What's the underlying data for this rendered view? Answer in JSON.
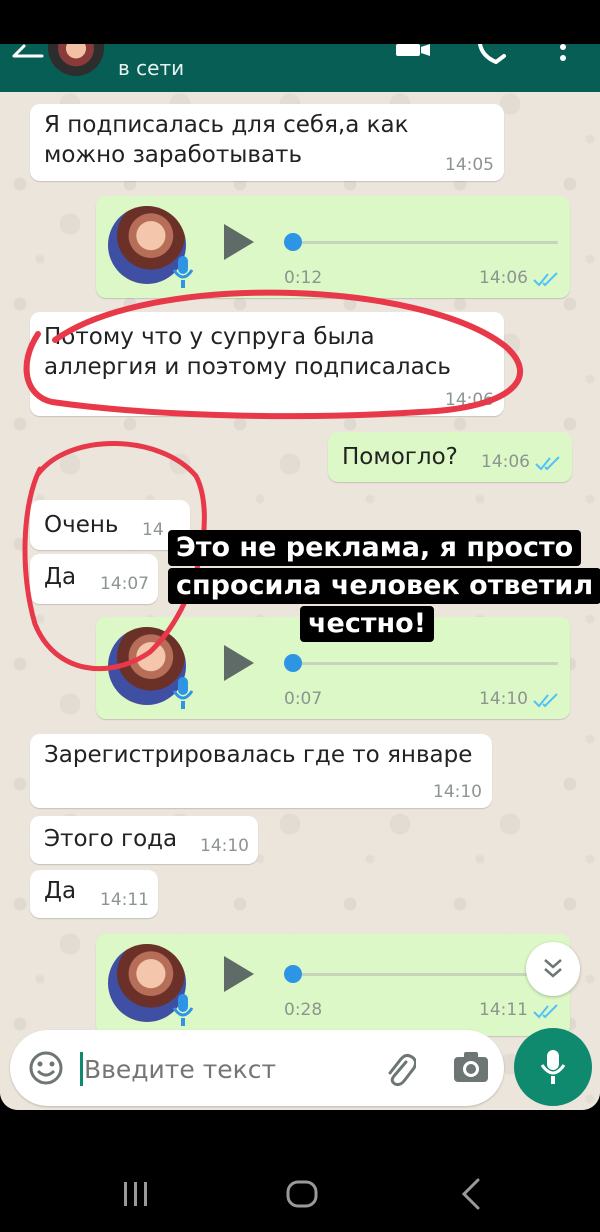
{
  "header": {
    "status": "в сети",
    "back_icon": "arrow-left-icon",
    "video_icon": "video-call-icon",
    "call_icon": "phone-icon",
    "menu_icon": "more-vertical-icon"
  },
  "messages": [
    {
      "type": "text",
      "side": "in",
      "lines": [
        "Я подписалась для себя,а как",
        "можно заработывать"
      ],
      "time": "14:05"
    },
    {
      "type": "voice",
      "side": "out",
      "duration": "0:12",
      "time": "14:06",
      "progress": 0
    },
    {
      "type": "text",
      "side": "in",
      "lines": [
        "Потому что у супруга была",
        "аллергия и поэтому подписалась"
      ],
      "time": "14:06"
    },
    {
      "type": "text",
      "side": "out",
      "lines": [
        "Помогло?"
      ],
      "time": "14:06"
    },
    {
      "type": "text",
      "side": "in",
      "lines": [
        "Очень"
      ],
      "time": "14"
    },
    {
      "type": "text",
      "side": "in",
      "lines": [
        "Да"
      ],
      "time": "14:07"
    },
    {
      "type": "voice",
      "side": "out",
      "duration": "0:07",
      "time": "14:10",
      "progress": 0
    },
    {
      "type": "text",
      "side": "in",
      "lines": [
        "Зарегистрировалась где то январе"
      ],
      "time": "14:10"
    },
    {
      "type": "text",
      "side": "in",
      "lines": [
        "Этого года"
      ],
      "time": "14:10"
    },
    {
      "type": "text",
      "side": "in",
      "lines": [
        "Да"
      ],
      "time": "14:11"
    },
    {
      "type": "voice",
      "side": "out",
      "duration": "0:28",
      "time": "14:11",
      "progress": 0
    }
  ],
  "overlay": {
    "lines": [
      "Это не реклама, я просто",
      "спросила человек ответил",
      "честно!"
    ]
  },
  "input": {
    "placeholder": "Введите текст",
    "emoji_icon": "emoji-icon",
    "attach_icon": "paperclip-icon",
    "camera_icon": "camera-icon",
    "mic_icon": "microphone-icon"
  },
  "scroll_down_icon": "double-chevron-down-icon",
  "nav": {
    "recents_icon": "recents-icon",
    "home_icon": "home-icon",
    "back_icon": "back-icon"
  },
  "colors": {
    "header": "#075e54",
    "outgoing_bubble": "#dcf8c6",
    "incoming_bubble": "#ffffff",
    "read_ticks": "#4fc3f7",
    "mic_button": "#0f8a6f",
    "annotation_red": "#e8394a"
  }
}
